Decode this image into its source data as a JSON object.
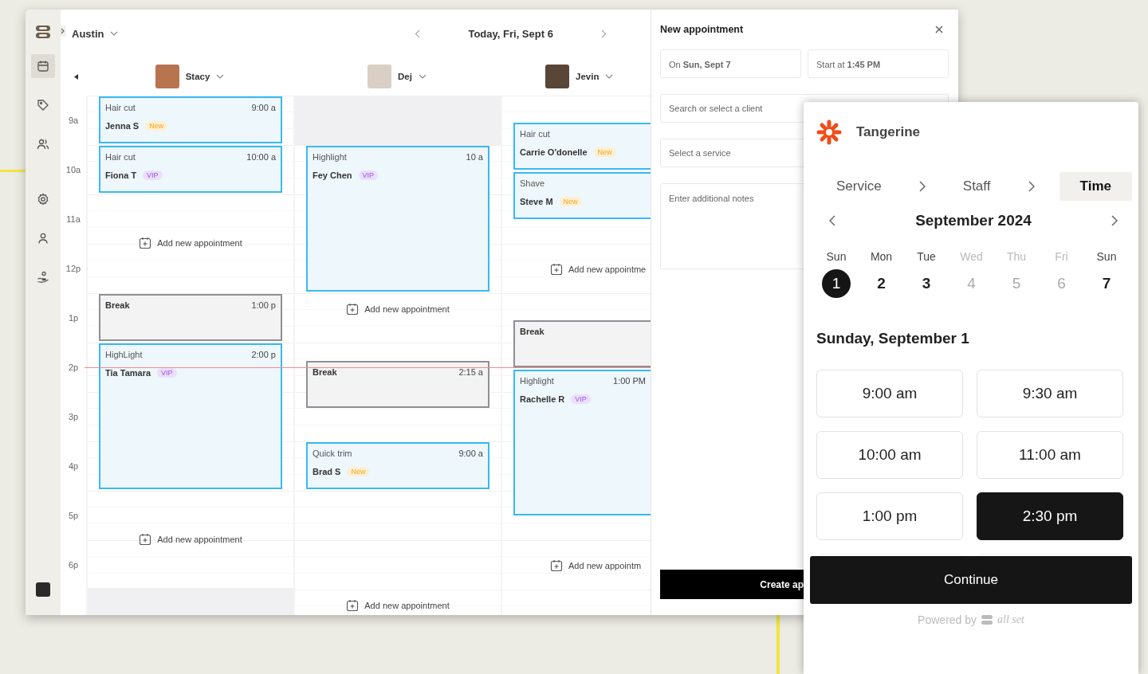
{
  "sidebar": {
    "location": "Austin",
    "nav": [
      {
        "selected": true
      },
      {
        "selected": false
      },
      {
        "selected": false
      },
      {
        "selected": false
      },
      {
        "selected": false
      },
      {
        "selected": false
      }
    ]
  },
  "date_nav": {
    "title": "Today, Fri, Sept 6"
  },
  "hours": [
    "9a",
    "10a",
    "11a",
    "12p",
    "1p",
    "2p",
    "3p",
    "4p",
    "5p",
    "6p"
  ],
  "staff": [
    {
      "name": "Stacy",
      "events": [
        {
          "kind": "appointment",
          "service": "Hair cut",
          "time": "9:00 a",
          "client": "Jenna S",
          "tag": {
            "label": "New",
            "kind": "new"
          }
        },
        {
          "kind": "appointment",
          "service": "Hair cut",
          "time": "10:00 a",
          "client": "Fiona T",
          "tag": {
            "label": "VIP",
            "kind": "vip"
          }
        },
        {
          "kind": "add",
          "label": "Add new appointment"
        },
        {
          "kind": "break",
          "service": "Break",
          "time": "1:00 p"
        },
        {
          "kind": "appointment",
          "service": "HighLight",
          "time": "2:00 p",
          "client": "Tia Tamara",
          "tag": {
            "label": "VIP",
            "kind": "vip"
          }
        },
        {
          "kind": "add",
          "label": "Add new appointment"
        },
        {
          "kind": "blocked"
        }
      ]
    },
    {
      "name": "Dej",
      "events": [
        {
          "kind": "blocked"
        },
        {
          "kind": "appointment",
          "service": "Highlight",
          "time": "10 a",
          "client": "Fey Chen",
          "tag": {
            "label": "VIP",
            "kind": "vip"
          }
        },
        {
          "kind": "add",
          "label": "Add new appointment"
        },
        {
          "kind": "break",
          "service": "Break",
          "time": "2:15 a"
        },
        {
          "kind": "appointment",
          "service": "Quick trim",
          "time": "9:00 a",
          "client": "Brad S",
          "tag": {
            "label": "New",
            "kind": "new"
          }
        },
        {
          "kind": "add",
          "label": "Add new appointment"
        }
      ]
    },
    {
      "name": "Jevin",
      "events": [
        {
          "kind": "appointment",
          "service": "Hair cut",
          "client": "Carrie O'donelle",
          "tag": {
            "label": "New",
            "kind": "new"
          }
        },
        {
          "kind": "appointment",
          "service": "Shave",
          "client": "Steve M",
          "tag": {
            "label": "New",
            "kind": "new"
          }
        },
        {
          "kind": "add",
          "label": "Add new appointme"
        },
        {
          "kind": "break",
          "service": "Break"
        },
        {
          "kind": "appointment",
          "service": "Highlight",
          "time": "1:00 PM",
          "client": "Rachelle R",
          "tag": {
            "label": "VIP",
            "kind": "vip"
          }
        },
        {
          "kind": "add",
          "label": "Add new appointm"
        }
      ]
    }
  ],
  "new_appointment": {
    "title": "New appointment",
    "date_field": "On **Sun, Sept 7**",
    "start_field": "Start at **1:45 PM**",
    "client_placeholder": "Search or select a client",
    "service_placeholder": "Select a service",
    "notes_placeholder": "Enter additional notes",
    "create_button": "Create ap"
  },
  "booking_widget": {
    "brand": "Tangerine",
    "steps": [
      {
        "label": "Service",
        "selected": false
      },
      {
        "label": "Staff",
        "selected": false
      },
      {
        "label": "Time",
        "selected": true
      }
    ],
    "month": "September 2024",
    "days": [
      {
        "weekday": "Sun",
        "date": "1",
        "selected": true,
        "disabled": false
      },
      {
        "weekday": "Mon",
        "date": "2",
        "selected": false,
        "disabled": false
      },
      {
        "weekday": "Tue",
        "date": "3",
        "selected": false,
        "disabled": false
      },
      {
        "weekday": "Wed",
        "date": "4",
        "selected": false,
        "disabled": true
      },
      {
        "weekday": "Thu",
        "date": "5",
        "selected": false,
        "disabled": true
      },
      {
        "weekday": "Fri",
        "date": "6",
        "selected": false,
        "disabled": true
      },
      {
        "weekday": "Sun",
        "date": "7",
        "selected": false,
        "disabled": false
      }
    ],
    "day_heading": "Sunday, September 1",
    "slots": [
      {
        "label": "9:00 am",
        "selected": false
      },
      {
        "label": "9:30 am",
        "selected": false
      },
      {
        "label": "10:00 am",
        "selected": false
      },
      {
        "label": "11:00 am",
        "selected": false
      },
      {
        "label": "1:00 pm",
        "selected": false
      },
      {
        "label": "2:30 pm",
        "selected": true
      }
    ],
    "continue_button": "Continue",
    "powered_by": "Powered by",
    "powered_brand": "all set"
  }
}
